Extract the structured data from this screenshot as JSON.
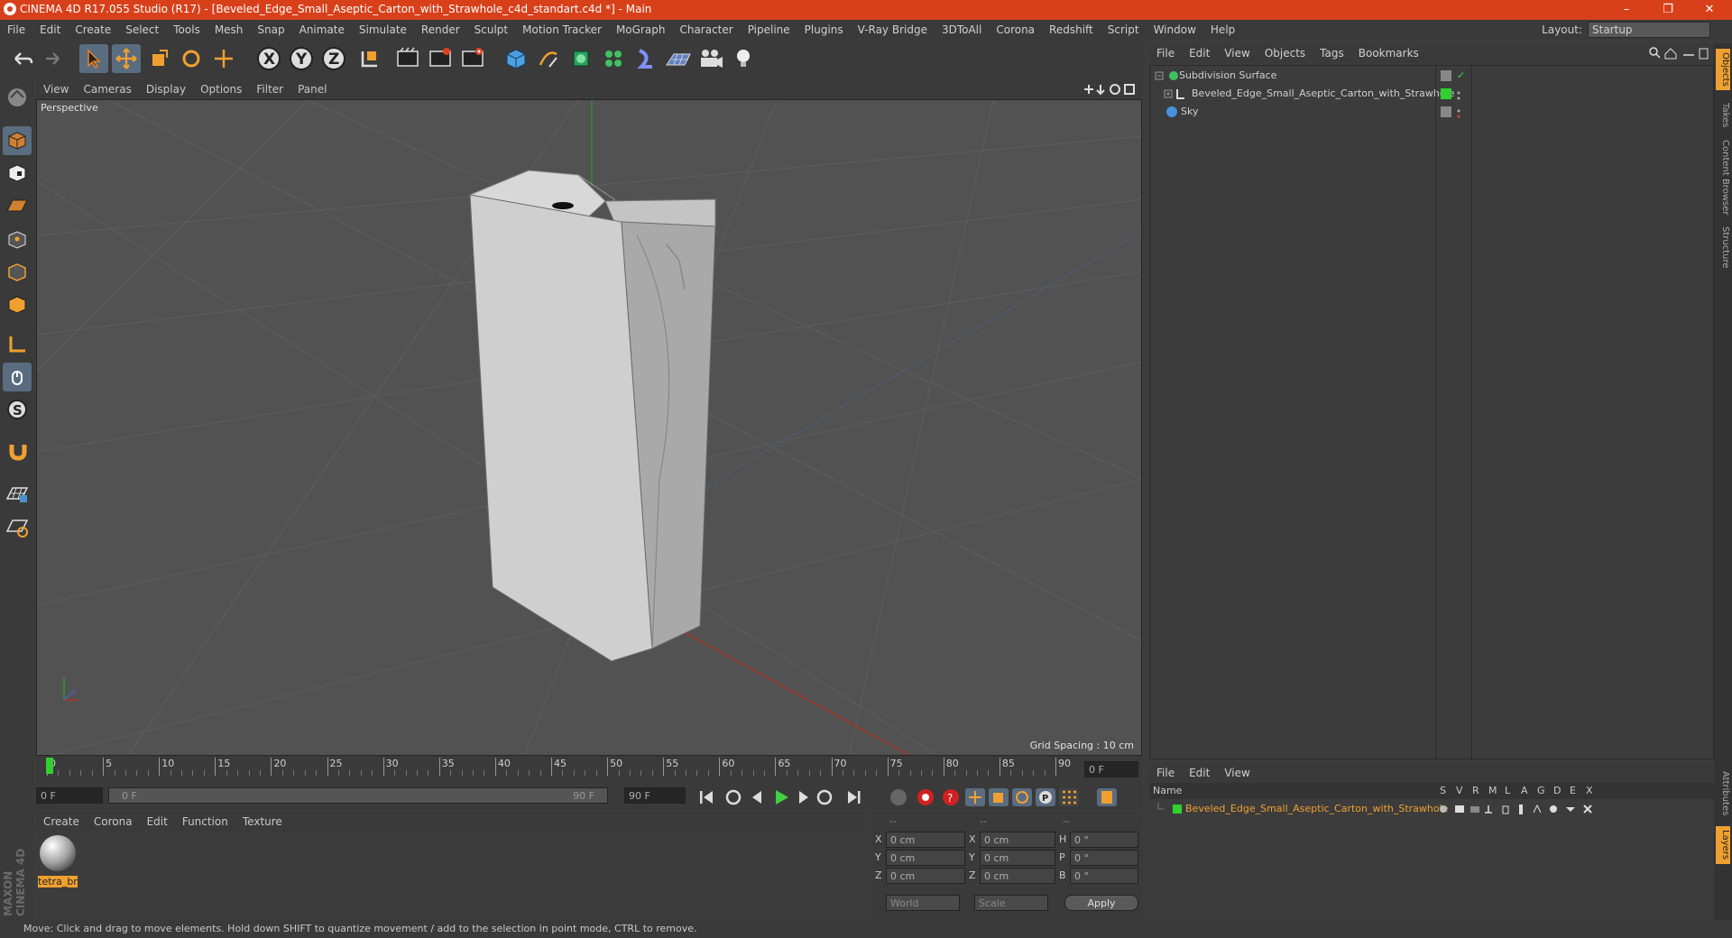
{
  "window": {
    "title": "CINEMA 4D R17.055 Studio (R17) - [Beveled_Edge_Small_Aseptic_Carton_with_Strawhole_c4d_standart.c4d *] - Main",
    "controls": [
      "–",
      "❐",
      "✕"
    ]
  },
  "menubar": {
    "items": [
      "File",
      "Edit",
      "Create",
      "Select",
      "Tools",
      "Mesh",
      "Snap",
      "Animate",
      "Simulate",
      "Render",
      "Sculpt",
      "Motion Tracker",
      "MoGraph",
      "Character",
      "Pipeline",
      "Plugins",
      "V-Ray Bridge",
      "3DToAll",
      "Corona",
      "Redshift",
      "Script",
      "Window",
      "Help"
    ],
    "layout_label": "Layout:",
    "layout_value": "Startup"
  },
  "viewport": {
    "menu": [
      "View",
      "Cameras",
      "Display",
      "Options",
      "Filter",
      "Panel"
    ],
    "label": "Perspective",
    "grid_spacing": "Grid Spacing : 10 cm"
  },
  "timeline": {
    "ticks": [
      "0",
      "5",
      "10",
      "15",
      "20",
      "25",
      "30",
      "35",
      "40",
      "45",
      "50",
      "55",
      "60",
      "65",
      "70",
      "75",
      "80",
      "85",
      "90"
    ],
    "current_frame": "0 F",
    "start_field": "0 F",
    "range_start": "0 F",
    "range_end": "90 F",
    "end_field": "90 F"
  },
  "materials": {
    "menu": [
      "Create",
      "Corona",
      "Edit",
      "Function",
      "Texture"
    ],
    "items": [
      {
        "name": "tetra_br"
      }
    ]
  },
  "coordinates": {
    "headers": [
      "--",
      "--",
      "--"
    ],
    "rows": [
      {
        "a": "X",
        "av": "0 cm",
        "b": "X",
        "bv": "0 cm",
        "c": "H",
        "cv": "0 °"
      },
      {
        "a": "Y",
        "av": "0 cm",
        "b": "Y",
        "bv": "0 cm",
        "c": "P",
        "cv": "0 °"
      },
      {
        "a": "Z",
        "av": "0 cm",
        "b": "Z",
        "bv": "0 cm",
        "c": "B",
        "cv": "0 °"
      }
    ],
    "mode": "World",
    "scale": "Scale",
    "apply": "Apply"
  },
  "objects": {
    "menu": [
      "File",
      "Edit",
      "View",
      "Objects",
      "Tags",
      "Bookmarks"
    ],
    "items": [
      {
        "name": "Subdivision Surface",
        "color": "#d0d0d0"
      },
      {
        "name": "Beveled_Edge_Small_Aseptic_Carton_with_Strawhole",
        "color": "#d0d0d0"
      },
      {
        "name": "Sky",
        "color": "#d0d0d0"
      }
    ]
  },
  "layers": {
    "menu": [
      "File",
      "Edit",
      "View"
    ],
    "columns": [
      "Name",
      "S",
      "V",
      "R",
      "M",
      "L",
      "A",
      "G",
      "D",
      "E",
      "X"
    ],
    "items": [
      {
        "name": "Beveled_Edge_Small_Aseptic_Carton_with_Strawhole",
        "color": "#f0a030"
      }
    ]
  },
  "side_tabs": [
    "Objects",
    "Takes",
    "Content Browser",
    "Structure"
  ],
  "side_tabs_bottom": [
    "Attributes",
    "Layers"
  ],
  "brand": "MAXON CINEMA 4D",
  "status": "Move: Click and drag to move elements. Hold down SHIFT to quantize movement / add to the selection in point mode, CTRL to remove.",
  "colors": {
    "titlebar": "#d8401a",
    "accent": "#5a6c80",
    "layer_text": "#f0a030"
  }
}
